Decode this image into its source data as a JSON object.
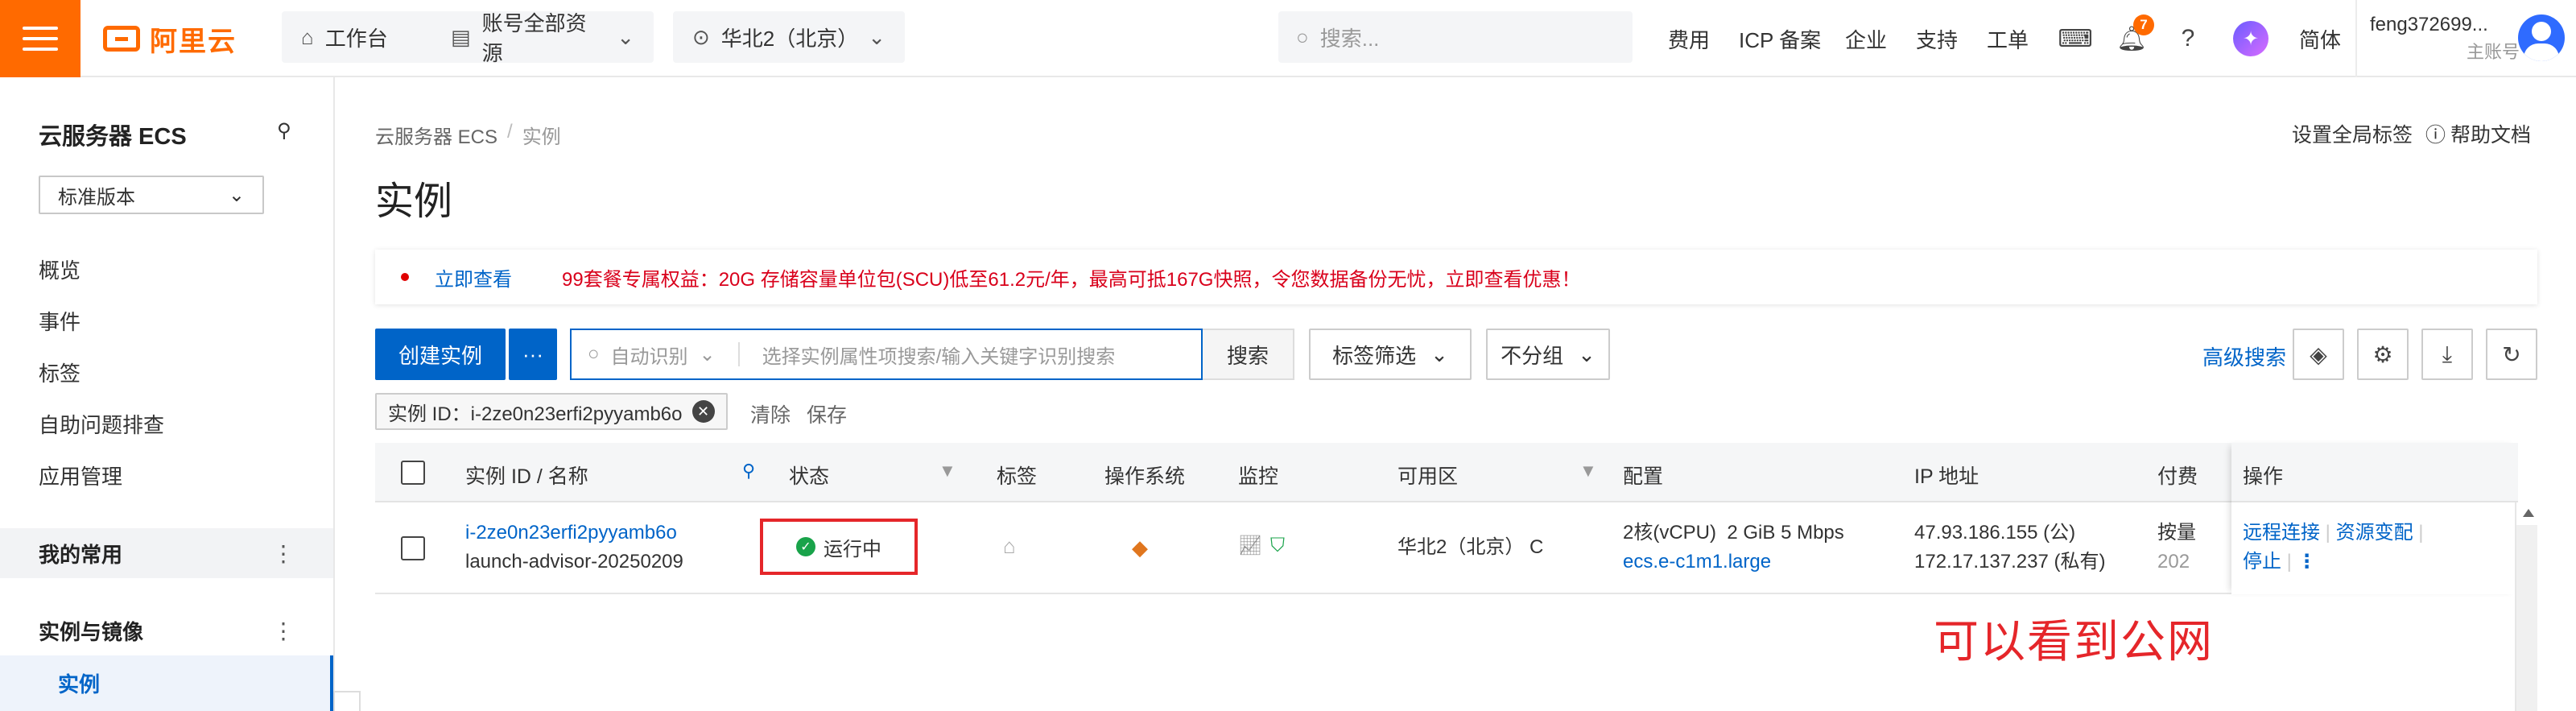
{
  "topbar": {
    "logo_text": "阿里云",
    "workbench": "工作台",
    "resources": "账号全部资源",
    "region": "华北2（北京）",
    "search_placeholder": "搜索...",
    "nav": [
      "费用",
      "ICP 备案",
      "企业",
      "支持",
      "工单"
    ],
    "notification_count": "7",
    "language": "简体",
    "account_name": "feng372699...",
    "account_type": "主账号",
    "brand_color": "#ff6a00"
  },
  "sidebar": {
    "title": "云服务器 ECS",
    "version_select": "标准版本",
    "items": [
      "概览",
      "事件",
      "标签",
      "自助问题排查",
      "应用管理"
    ],
    "group_favorites": "我的常用",
    "group_instances": "实例与镜像",
    "active_item": "实例"
  },
  "main": {
    "breadcrumb": [
      "云服务器 ECS",
      "/",
      "实例"
    ],
    "title": "实例",
    "global_tag": "设置全局标签",
    "help_doc": "帮助文档",
    "promo_link": "立即查看",
    "promo_text": "99套餐专属权益：20G 存储容量单位包(SCU)低至61.2元/年，最高可抵167G快照，令您数据备份无忧，立即查看优惠！",
    "create_button": "创建实例",
    "more_button": "···",
    "search_auto": "自动识别",
    "search_placeholder": "选择实例属性项搜索/输入关键字识别搜索",
    "search_button": "搜索",
    "tag_filter": "标签筛选",
    "group_select": "不分组",
    "advanced_search": "高级搜索",
    "filter_chip": "实例 ID：i-2ze0n23erfi2pyyamb6o",
    "clear": "清除",
    "save": "保存"
  },
  "table": {
    "headers": [
      "实例 ID / 名称",
      "状态",
      "标签",
      "操作系统",
      "监控",
      "可用区",
      "配置",
      "IP 地址",
      "付费",
      "操作"
    ],
    "row": {
      "instance_id": "i-2ze0n23erfi2pyyamb6o",
      "instance_name": "launch-advisor-20250209",
      "status": "运行中",
      "zone": "华北2（北京） C",
      "config_cpu": "2核(vCPU)",
      "config_mem": "2 GiB",
      "config_bw": "5 Mbps",
      "config_type": "ecs.e-c1m1.large",
      "ip_public": "47.93.186.155 (公)",
      "ip_private": "172.17.137.237 (私有)",
      "pay_type": "按量",
      "pay_date": "202",
      "ops": [
        "远程连接",
        "资源变配",
        "停止"
      ]
    }
  },
  "annotation": "可以看到公网",
  "colors": {
    "primary": "#0064c8",
    "accent": "#ff6a00",
    "running": "#19a34a",
    "highlight": "#e5262a"
  }
}
